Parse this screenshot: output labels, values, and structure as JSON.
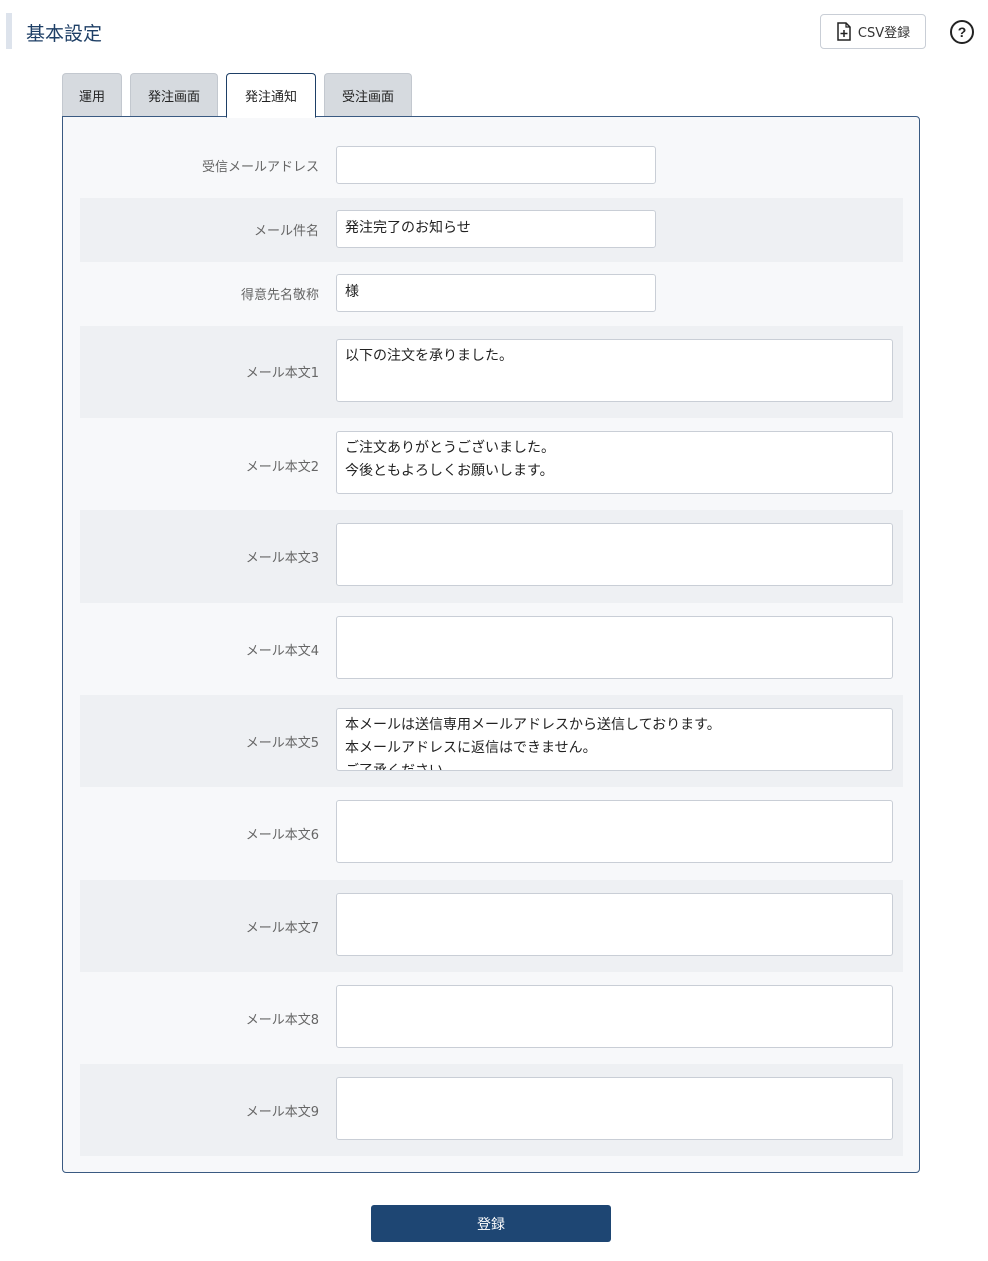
{
  "header": {
    "title": "基本設定",
    "csv_button_label": "CSV登録",
    "csv_icon": "file-plus-icon",
    "help_icon": "question-circle-icon"
  },
  "tabs": [
    {
      "label": "運用",
      "active": false
    },
    {
      "label": "発注画面",
      "active": false
    },
    {
      "label": "発注通知",
      "active": true
    },
    {
      "label": "受注画面",
      "active": false
    }
  ],
  "form": {
    "fields": [
      {
        "label": "受信メールアドレス",
        "value": ""
      },
      {
        "label": "メール件名",
        "value": "発注完了のお知らせ"
      },
      {
        "label": "得意先名敬称",
        "value": "様"
      },
      {
        "label": "メール本文1",
        "value": "以下の注文を承りました。"
      },
      {
        "label": "メール本文2",
        "value": "ご注文ありがとうございました。\n今後ともよろしくお願いします。"
      },
      {
        "label": "メール本文3",
        "value": ""
      },
      {
        "label": "メール本文4",
        "value": ""
      },
      {
        "label": "メール本文5",
        "value": "本メールは送信専用メールアドレスから送信しております。\n本メールアドレスに返信はできません。\nご了承ください。"
      },
      {
        "label": "メール本文6",
        "value": ""
      },
      {
        "label": "メール本文7",
        "value": ""
      },
      {
        "label": "メール本文8",
        "value": ""
      },
      {
        "label": "メール本文9",
        "value": ""
      }
    ]
  },
  "submit_label": "登録",
  "colors": {
    "accent": "#1e4673",
    "title": "#1e3f66",
    "tab_inactive": "#d6dadf",
    "row_shade": "#eef0f3"
  }
}
